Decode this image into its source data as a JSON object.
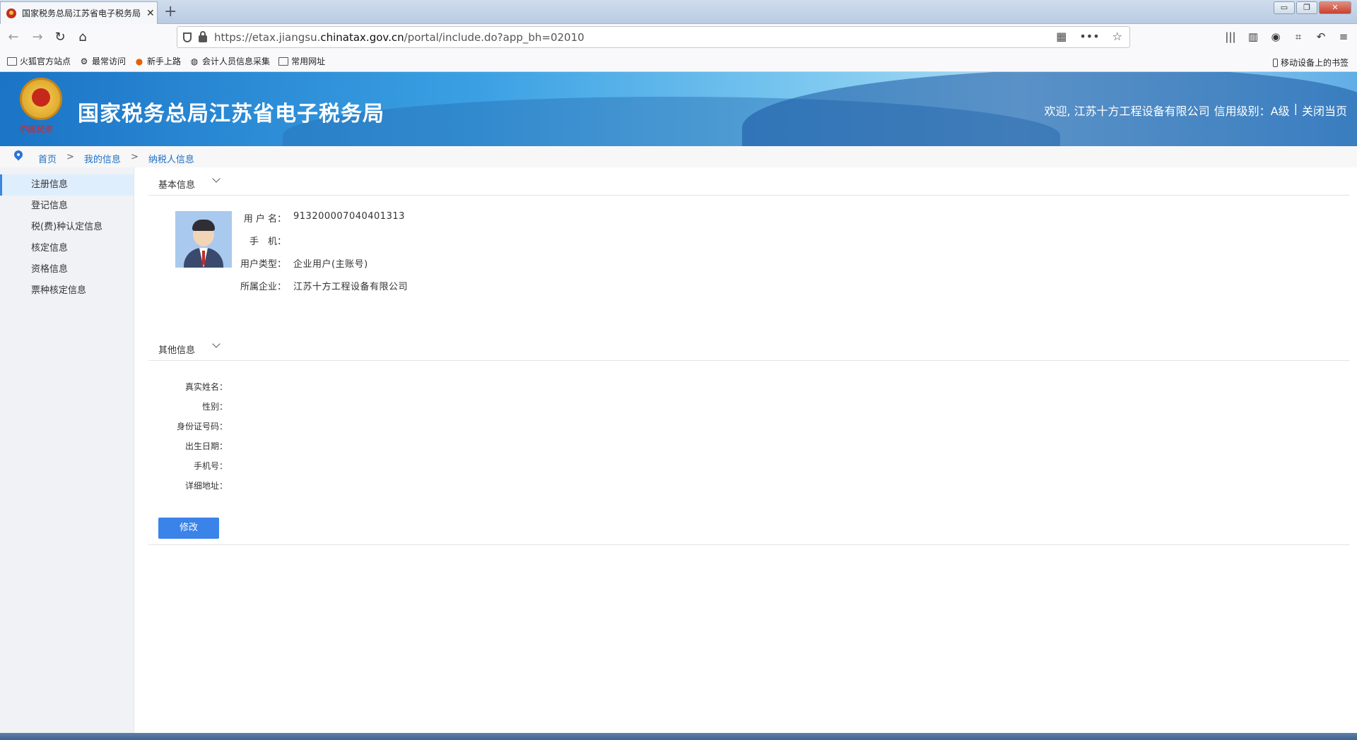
{
  "browser": {
    "tab_title": "国家税务总局江苏省电子税务局",
    "tab_close": "✕",
    "new_tab": "+",
    "window_buttons": [
      "▭",
      "❐",
      "✕"
    ],
    "url_prefix": "https://etax.jiangsu.",
    "url_domain": "chinatax.gov.cn",
    "url_path": "/portal/include.do?app_bh=02010",
    "nav_icons": [
      "back-icon",
      "forward-icon",
      "reload-icon",
      "home-icon"
    ],
    "toolbar_icons": [
      "library-icon",
      "sidebar-icon",
      "account-icon",
      "crop-icon",
      "undo-icon",
      "menu-icon"
    ]
  },
  "bookmarks": {
    "items": [
      {
        "label": "火狐官方站点",
        "icon": "folder-icon"
      },
      {
        "label": "最常访问",
        "icon": "gear-icon"
      },
      {
        "label": "新手上路",
        "icon": "firefox-icon"
      },
      {
        "label": "会计人员信息采集",
        "icon": "globe-icon"
      },
      {
        "label": "常用网址",
        "icon": "folder-icon"
      }
    ],
    "mobile": "移动设备上的书签"
  },
  "header": {
    "site_title": "国家税务总局江苏省电子税务局",
    "seal_text": "中国税务",
    "welcome": "欢迎, 江苏十方工程设备有限公司",
    "credit": "信用级别：A级",
    "separator": "|",
    "close_page": "关闭当页"
  },
  "breadcrumb": {
    "home": "首页",
    "my_info": "我的信息",
    "current": "纳税人信息",
    "sep": ">"
  },
  "sidebar": {
    "items": [
      {
        "label": "注册信息",
        "active": true
      },
      {
        "label": "登记信息"
      },
      {
        "label": "税(费)种认定信息"
      },
      {
        "label": "核定信息"
      },
      {
        "label": "资格信息"
      },
      {
        "label": "票种核定信息"
      }
    ]
  },
  "basic": {
    "title": "基本信息",
    "fields": [
      {
        "label": "用 户 名：",
        "value": "913200007040401313"
      },
      {
        "label": "手　机：",
        "value": ""
      },
      {
        "label": "用户类型：",
        "value": "企业用户(主账号)"
      },
      {
        "label": "所属企业：",
        "value": "江苏十方工程设备有限公司"
      }
    ]
  },
  "other": {
    "title": "其他信息",
    "fields": [
      {
        "label": "真实姓名：",
        "value": ""
      },
      {
        "label": "性别：",
        "value": ""
      },
      {
        "label": "身份证号码：",
        "value": ""
      },
      {
        "label": "出生日期：",
        "value": ""
      },
      {
        "label": "手机号：",
        "value": ""
      },
      {
        "label": "详细地址：",
        "value": ""
      }
    ],
    "edit_button": "修改"
  },
  "colors": {
    "accent": "#3a83e8",
    "link": "#1f6fc5",
    "banner": "#3aa0e3"
  }
}
